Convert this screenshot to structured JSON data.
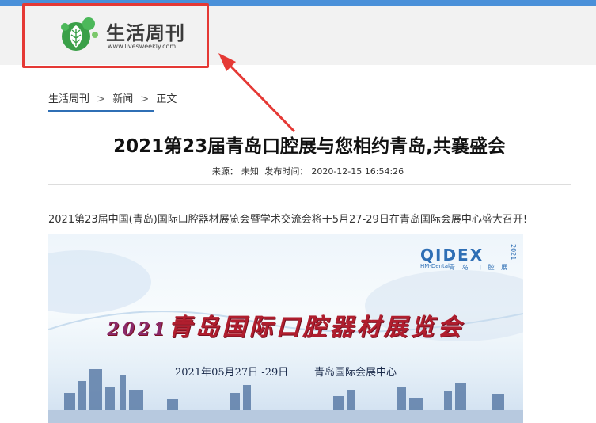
{
  "site": {
    "name": "生活周刊",
    "url": "www.livesweekly.com"
  },
  "breadcrumb": {
    "items": [
      "生活周刊",
      "新闻",
      "正文"
    ],
    "separator": ">"
  },
  "article": {
    "title": "2021第23届青岛口腔展与您相约青岛,共襄盛会",
    "source_label": "来源：",
    "source_value": "未知",
    "time_label": "发布时间：",
    "time_value": "2020-12-15 16:54:26",
    "paragraph": "2021第23届中国(青岛)国际口腔器材展览会暨学术交流会将于5月27-29日在青岛国际会展中心盛大召开!"
  },
  "poster": {
    "brand": "QIDEX",
    "brand_sub": "HM-Dental",
    "brand_cn": "青 岛 口 腔 展",
    "year_vertical": "2021",
    "title_year": "2021",
    "title_text": "青岛国际口腔器材展览会",
    "date": "2021年05月27日 -29日",
    "venue": "青岛国际会展中心"
  },
  "colors": {
    "topbar": "#4a90d9",
    "header_bg": "#f2f2f2",
    "logo_green": "#3aa048",
    "highlight_red": "#e53935",
    "link_blue": "#2f6fb5",
    "poster_title_red": "#b01e2e"
  }
}
